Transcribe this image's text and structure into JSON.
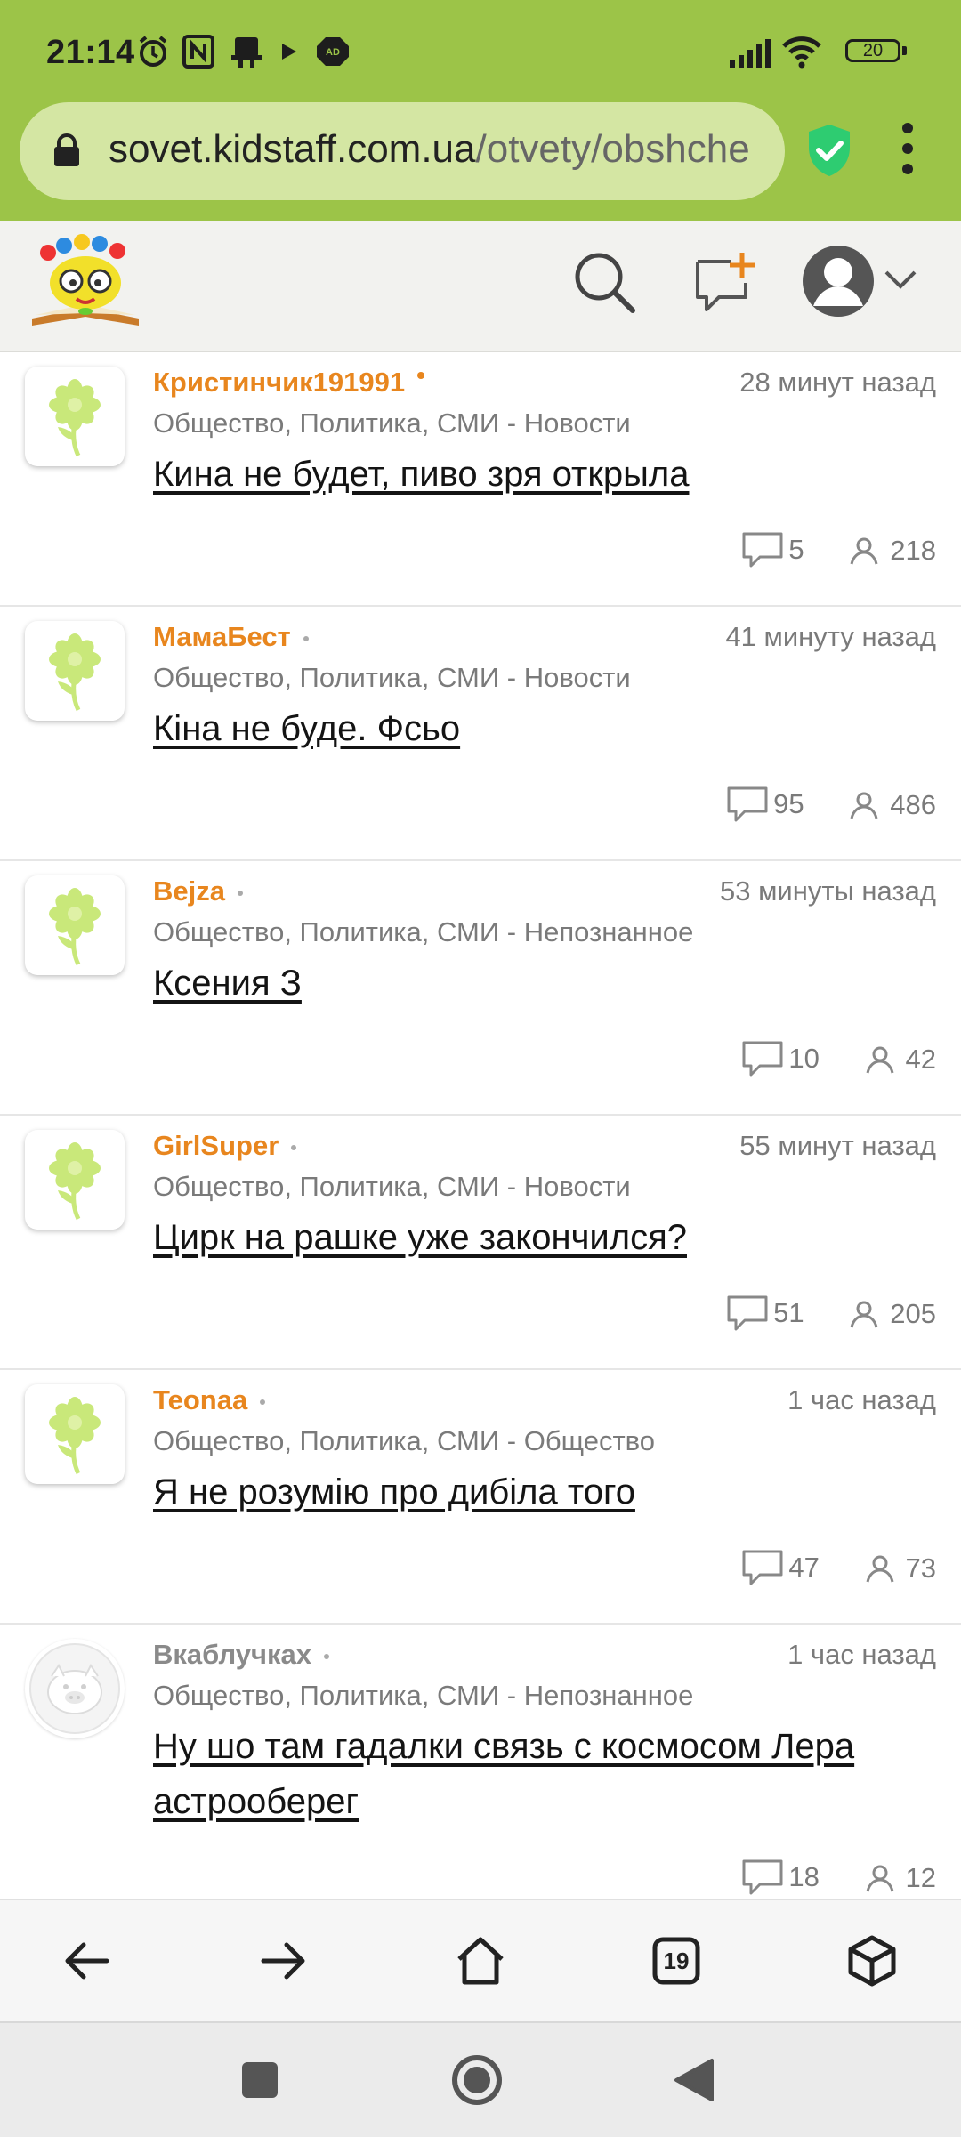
{
  "status_bar": {
    "time": "21:14",
    "battery": "20",
    "icons": [
      "alarm-icon",
      "nfc-icon",
      "app-notification-icon",
      "play-icon",
      "adblock-icon",
      "signal-icon",
      "wifi-icon",
      "battery-icon"
    ]
  },
  "browser": {
    "url_host": "sovet.kidstaff.com.ua",
    "url_path": "/otvety/obshche",
    "tab_count": "19"
  },
  "colors": {
    "toolbar": "#9cc448",
    "author": "#e8861e",
    "shield": "#2ecc71"
  },
  "posts": [
    {
      "author": "Кристинчик191991",
      "time": "28 минут назад",
      "category": "Общество, Политика, СМИ - Новости",
      "title": "Кина не будет, пиво зря открыла",
      "comments": "5",
      "views": "218"
    },
    {
      "author": "МамаБест",
      "time": "41 минуту назад",
      "category": "Общество, Политика, СМИ - Новости",
      "title": "Кіна не буде. Фсьо",
      "comments": "95",
      "views": "486"
    },
    {
      "author": "Bejza",
      "time": "53 минуты назад",
      "category": "Общество, Политика, СМИ - Непознанное",
      "title": "Ксения З",
      "comments": "10",
      "views": "42"
    },
    {
      "author": "GirlSuper",
      "time": "55 минут назад",
      "category": "Общество, Политика, СМИ - Новости",
      "title": "Цирк на рашке уже закончился?",
      "comments": "51",
      "views": "205"
    },
    {
      "author": "Teonaa",
      "time": "1 час назад",
      "category": "Общество, Политика, СМИ - Общество",
      "title": "Я не розумію про дибіла того",
      "comments": "47",
      "views": "73"
    },
    {
      "author": "Вкаблучках",
      "time": "1 час назад",
      "category": "Общество, Политика, СМИ - Непознанное",
      "title": "Ну шо там гадалки связь с космосом Лера астрооберег",
      "comments": "18",
      "views": "12"
    }
  ]
}
